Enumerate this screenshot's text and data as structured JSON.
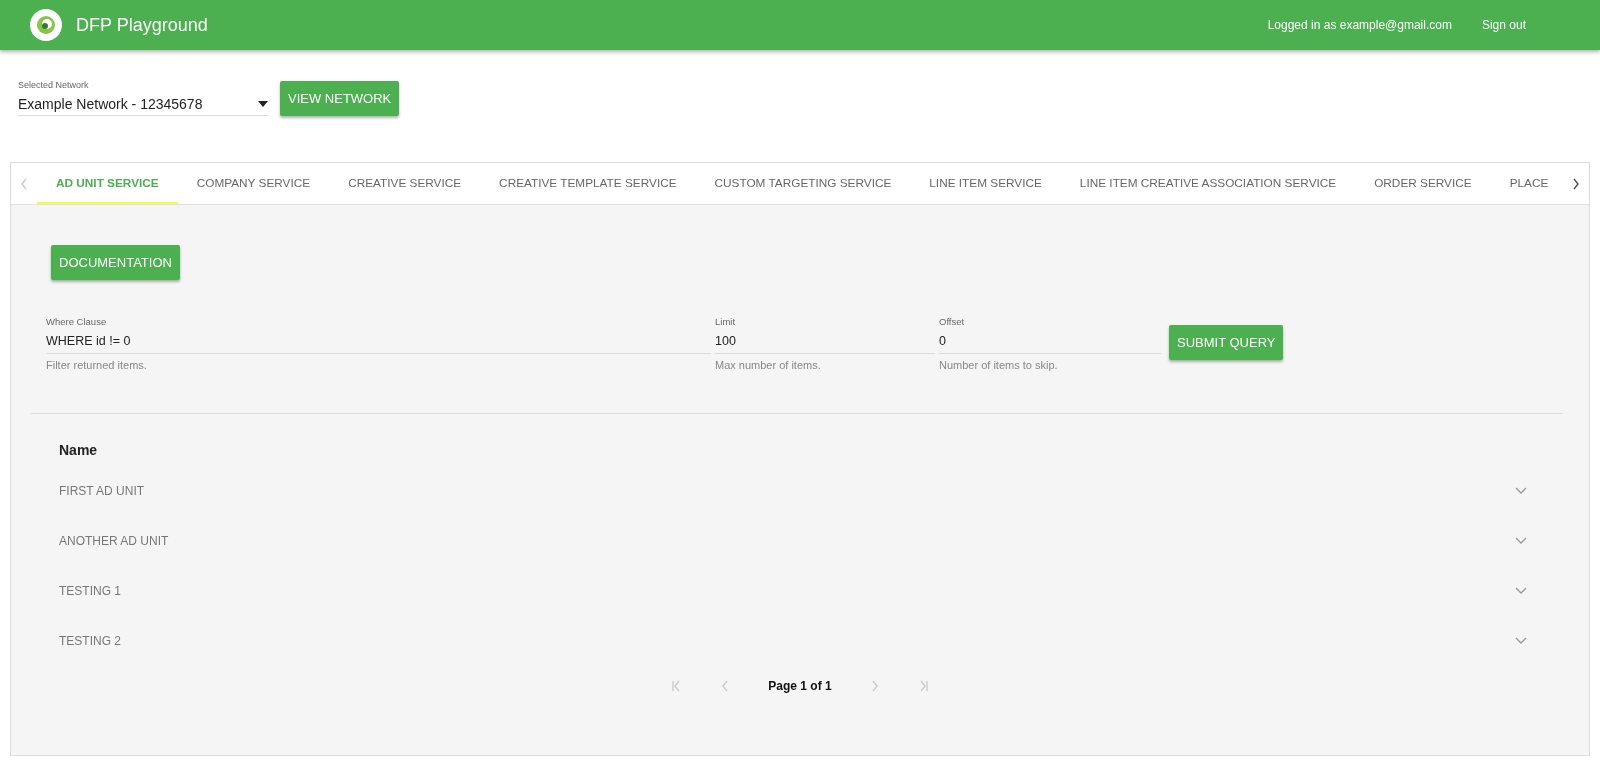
{
  "header": {
    "title": "DFP Playground",
    "user": "Logged in as example@gmail.com",
    "sign_out": "Sign out"
  },
  "network": {
    "label": "Selected Network",
    "value": "Example Network - 12345678",
    "button": "VIEW NETWORK"
  },
  "tabs": [
    {
      "label": "AD UNIT SERVICE",
      "selected": true
    },
    {
      "label": "COMPANY SERVICE",
      "selected": false
    },
    {
      "label": "CREATIVE SERVICE",
      "selected": false
    },
    {
      "label": "CREATIVE TEMPLATE SERVICE",
      "selected": false
    },
    {
      "label": "CUSTOM TARGETING SERVICE",
      "selected": false
    },
    {
      "label": "LINE ITEM SERVICE",
      "selected": false
    },
    {
      "label": "LINE ITEM CREATIVE ASSOCIATION SERVICE",
      "selected": false
    },
    {
      "label": "ORDER SERVICE",
      "selected": false
    },
    {
      "label": "PLACE",
      "selected": false
    }
  ],
  "documentation_button": "DOCUMENTATION",
  "query": {
    "fields": [
      {
        "label": "Where Clause",
        "value": "WHERE id != 0",
        "hint": "Filter returned items."
      },
      {
        "label": "Limit",
        "value": "100",
        "hint": "Max number of items."
      },
      {
        "label": "Offset",
        "value": "0",
        "hint": "Number of items to skip."
      }
    ],
    "submit": "SUBMIT QUERY"
  },
  "table": {
    "columns": [
      "Name"
    ],
    "rows": [
      {
        "name": "FIRST AD UNIT",
        "expanded": false
      },
      {
        "name": "ANOTHER AD UNIT",
        "expanded": false
      },
      {
        "name": "TESTING 1",
        "expanded": false
      },
      {
        "name": "TESTING 2",
        "expanded": false
      }
    ]
  },
  "pagination": {
    "label": "Page 1 of 1",
    "first_disabled": true,
    "prev_disabled": true,
    "next_disabled": true,
    "last_disabled": true
  }
}
